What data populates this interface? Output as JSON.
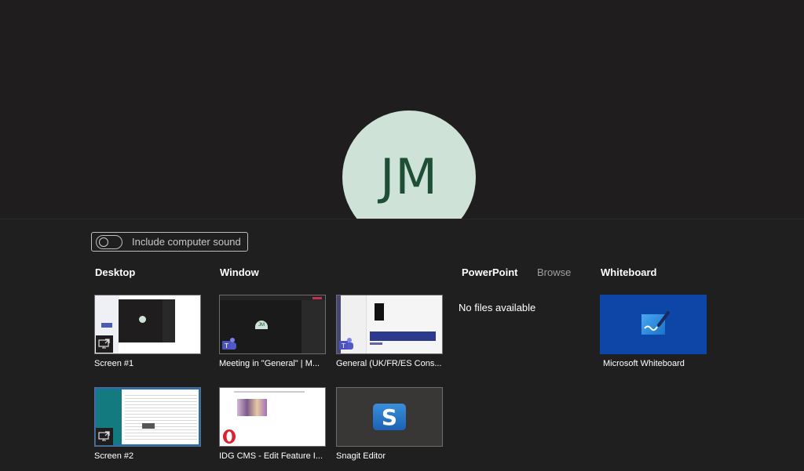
{
  "participant": {
    "initials": "JM",
    "avatar_bg": "#cfe2d7",
    "avatar_fg": "#1e4f34"
  },
  "share_panel": {
    "include_sound": {
      "label": "Include computer sound",
      "on": false
    },
    "sections": {
      "desktop": "Desktop",
      "window": "Window",
      "powerpoint": "PowerPoint",
      "browse": "Browse",
      "whiteboard": "Whiteboard"
    },
    "powerpoint_empty": "No files available",
    "desktop_items": [
      {
        "label": "Screen #1",
        "icon": "screen-share-icon"
      },
      {
        "label": "Screen #2",
        "icon": "screen-share-icon"
      }
    ],
    "window_items": [
      {
        "label": "Meeting in \"General\" | M...",
        "icon": "teams-icon"
      },
      {
        "label": "General (UK/FR/ES Cons...",
        "icon": "teams-icon"
      },
      {
        "label": "IDG CMS - Edit Feature I...",
        "icon": "opera-icon"
      },
      {
        "label": "Snagit Editor",
        "icon": "snagit-icon"
      }
    ],
    "whiteboard_items": [
      {
        "label": "Microsoft Whiteboard",
        "icon": "whiteboard-icon"
      }
    ],
    "thumb_av_initials": "JM",
    "snagit_glyph": "S"
  }
}
